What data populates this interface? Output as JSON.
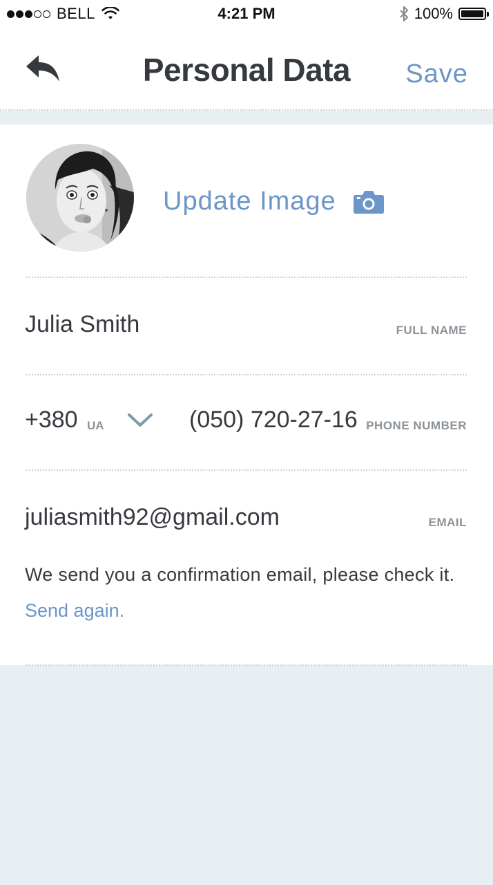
{
  "status_bar": {
    "carrier": "BELL",
    "time": "4:21 PM",
    "battery": "100%"
  },
  "nav": {
    "title": "Personal Data",
    "save_label": "Save"
  },
  "profile": {
    "update_image_label": "Update Image"
  },
  "fields": {
    "full_name": {
      "value": "Julia Smith",
      "label": "FULL NAME"
    },
    "phone": {
      "country_code": "+380",
      "country_iso": "UA",
      "number": "(050) 720-27-16",
      "label": "PHONE NUMBER"
    },
    "email": {
      "value": "juliasmith92@gmail.com",
      "label": "EMAIL"
    }
  },
  "confirmation": {
    "message": "We send you a confirmation email, please check it.",
    "send_again": "Send again."
  },
  "colors": {
    "accent": "#6c95c8",
    "text": "#363a3f",
    "muted": "#8c9398",
    "background": "#e7eff2"
  }
}
